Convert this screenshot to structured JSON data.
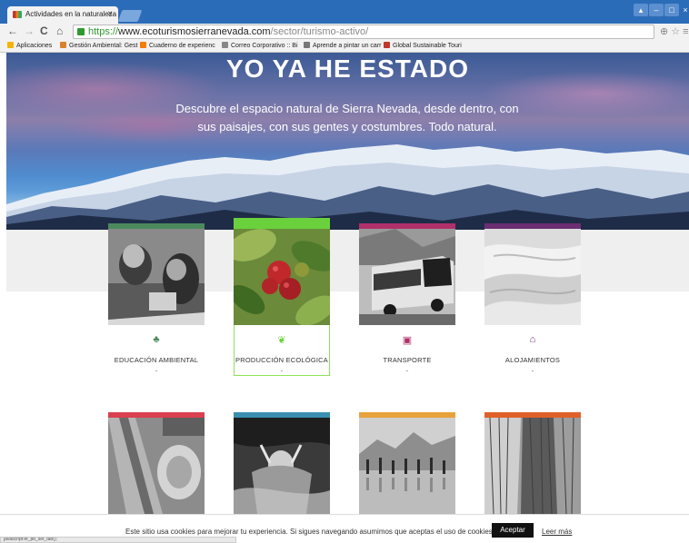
{
  "browser": {
    "tab_title": "Actividades en la naturaleza",
    "tab_close": "×",
    "url_scheme": "https://",
    "url_host": "www.ecoturismosierranevada.com",
    "url_path": "/sector/turismo-activo/",
    "nav": {
      "back": "←",
      "forward": "→",
      "reload": "C",
      "home": "⌂"
    },
    "omni_icons": "⊕☆≡",
    "bookmarks": [
      {
        "label": "Aplicaciones",
        "icon": "apps-grid-icon",
        "color": "#f4b400"
      },
      {
        "label": "Gestión Ambiental: Gest",
        "icon": "bookmark-icon",
        "color": "#d9822b"
      },
      {
        "label": "Cuaderno de experienc",
        "icon": "blogger-icon",
        "color": "#f57d00"
      },
      {
        "label": "Correo Corporativo :: Bi",
        "icon": "mail-icon",
        "color": "#888888"
      },
      {
        "label": "Aprende a pintar un carr",
        "icon": "page-icon",
        "color": "#777777"
      },
      {
        "label": "Global Sustainable Touri",
        "icon": "link-icon",
        "color": "#c0392b"
      }
    ]
  },
  "hero": {
    "title": "YO YA HE ESTADO",
    "subtitle": "Descubre el espacio natural de Sierra Nevada, desde dentro, con sus paisajes, con sus gentes y costumbres. Todo natural."
  },
  "cards_row1": [
    {
      "label": "EDUCACIÓN AMBIENTAL",
      "icon": "tree-icon",
      "glyph": "♣",
      "color": "#4a8a5c"
    },
    {
      "label": "PRODUCCIÓN ECOLÓGICA",
      "icon": "leaf-icon",
      "glyph": "❦",
      "color": "#6ad13c"
    },
    {
      "label": "TRANSPORTE",
      "icon": "bus-icon",
      "glyph": "▣",
      "color": "#b0306a"
    },
    {
      "label": "ALOJAMIENTOS",
      "icon": "home-icon",
      "glyph": "⌂",
      "color": "#6b2e72"
    }
  ],
  "cards_row2": [
    {
      "color": "#d94050"
    },
    {
      "color": "#3a8fb0"
    },
    {
      "color": "#e8a23a"
    },
    {
      "color": "#e0602a"
    }
  ],
  "cookie": {
    "text": "Este sitio usa cookies para mejorar tu experiencia. Si sigues navegando asumimos que aceptas el uso de cookies",
    "accept": "Aceptar",
    "more": "Leer más"
  },
  "status": "javascript:et_pb_set_tab();"
}
